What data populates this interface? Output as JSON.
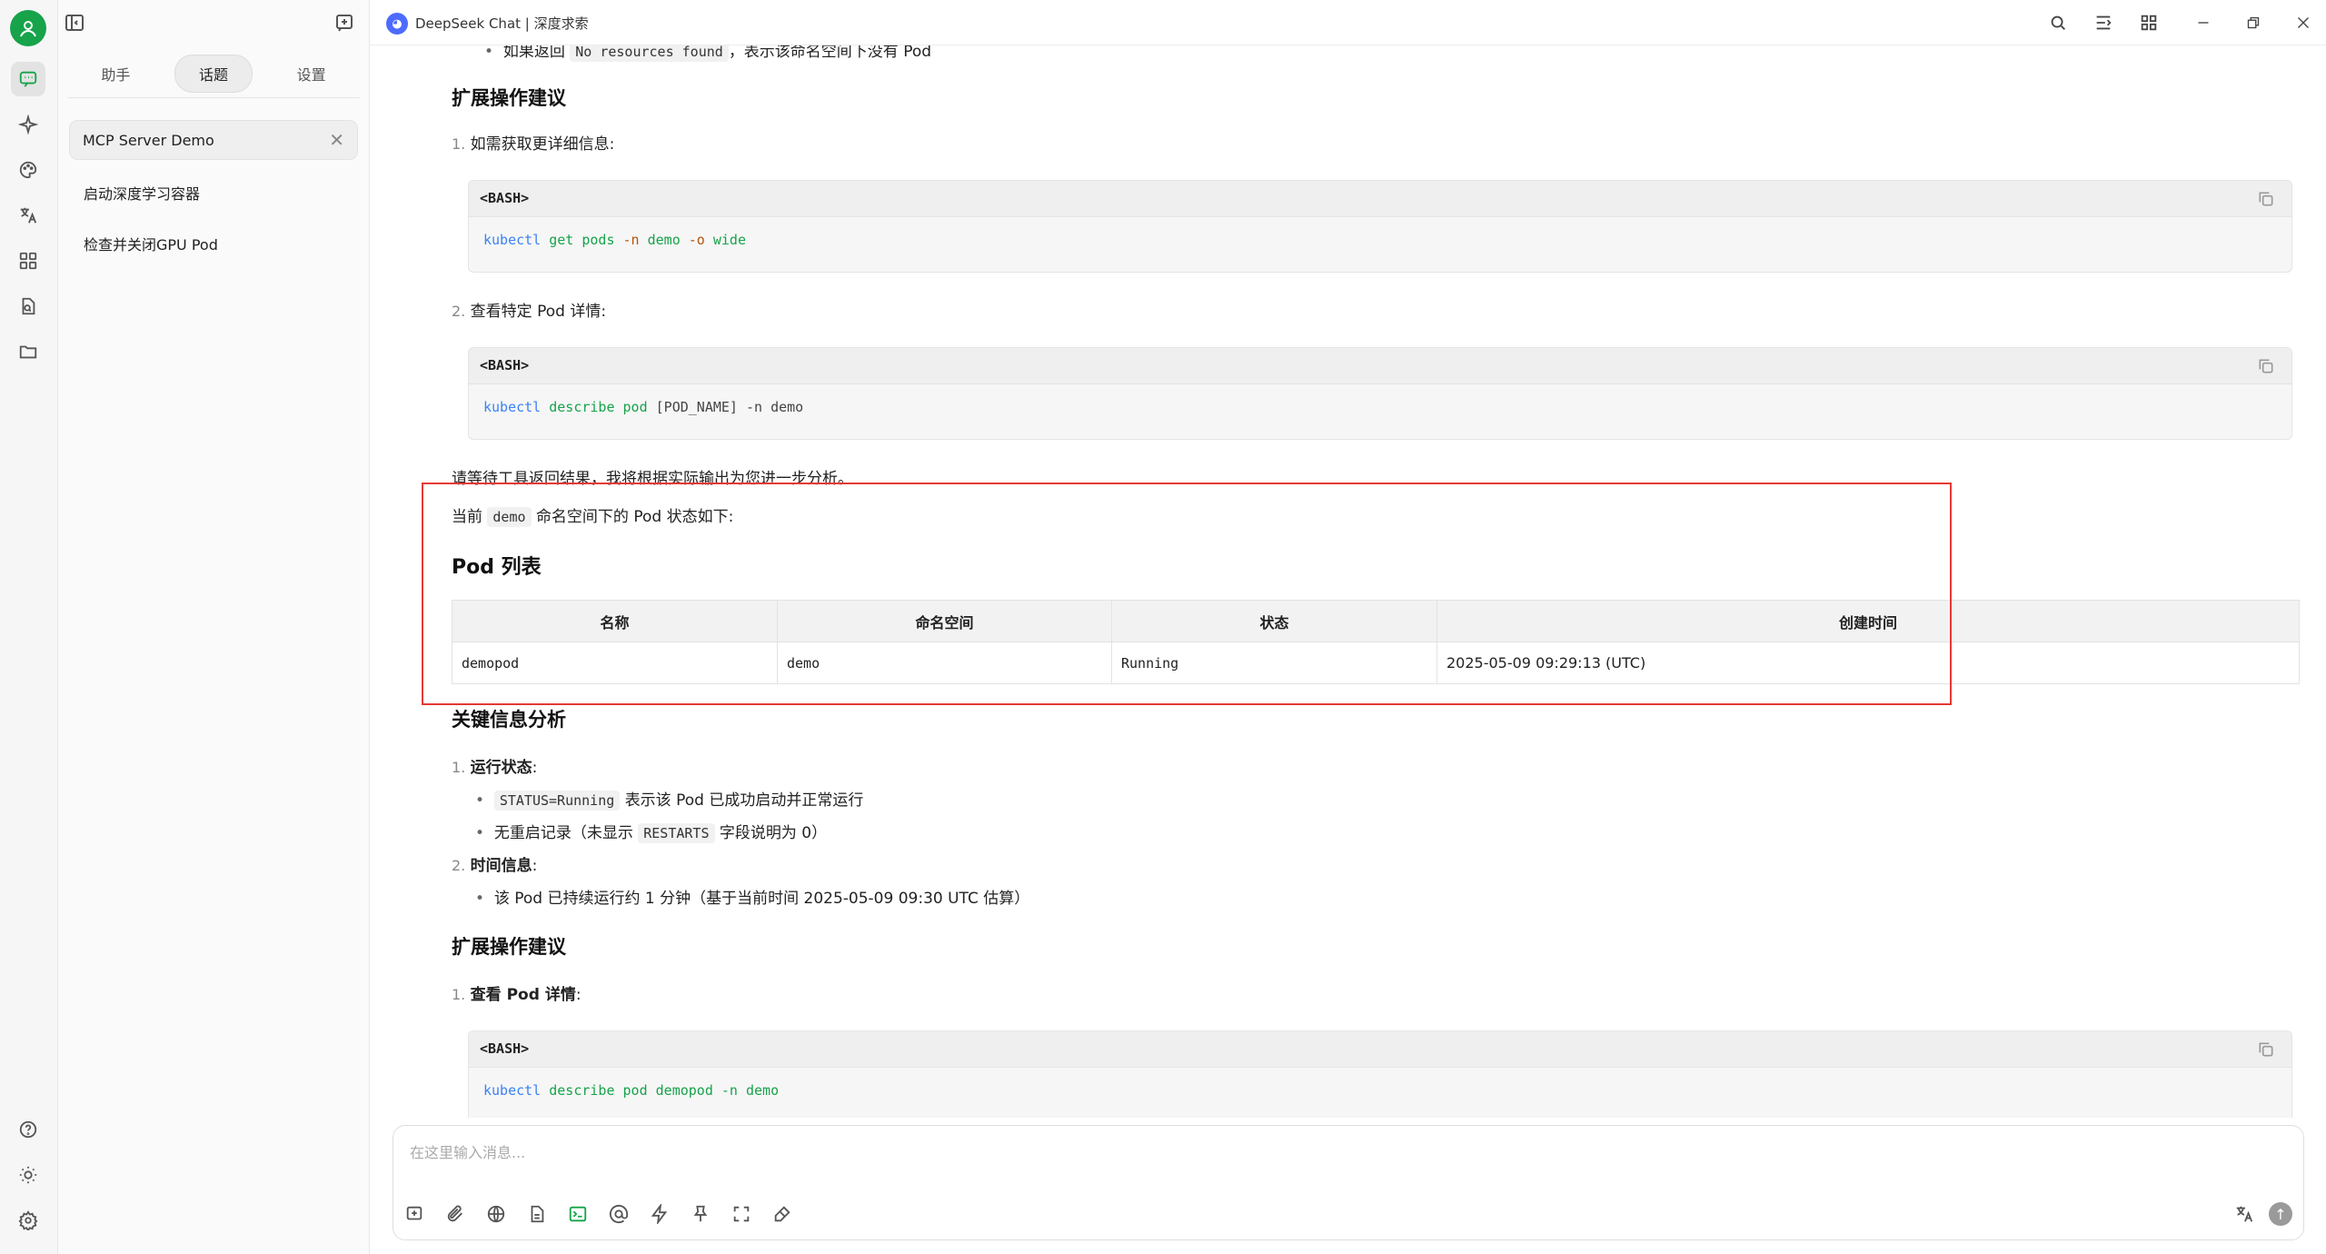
{
  "window": {
    "title": "DeepSeek Chat | 深度求索"
  },
  "sidebar": {
    "tabs": [
      "助手",
      "话题",
      "设置"
    ],
    "active_tab": "话题",
    "search_value": "MCP Server Demo",
    "topics": [
      "启动深度学习容器",
      "检查并关闭GPU Pod"
    ]
  },
  "chat": {
    "top_partial": {
      "prefix": "如果返回 ",
      "code": "No resources found",
      "suffix": "，表示该命名空间下没有 Pod"
    },
    "section1_title": "扩展操作建议",
    "s1_item1": "如需获取更详细信息:",
    "s1_code1": {
      "lang": "<BASH>",
      "cmd": "kubectl",
      "tokens": [
        "get",
        "pods",
        "-n",
        "demo",
        "-o",
        "wide"
      ]
    },
    "s1_item2": "查看特定 Pod 详情:",
    "s1_code2": {
      "lang": "<BASH>",
      "cmd": "kubectl",
      "sub": "describe pod",
      "arg": "[POD_NAME]",
      "flag": "-n demo"
    },
    "wait_note": "请等待工具返回结果，我将根据实际输出为您进一步分析。",
    "intro_prefix": "当前",
    "intro_code": "demo",
    "intro_suffix": "命名空间下的 Pod 状态如下:",
    "pod_list_title": "Pod 列表",
    "table": {
      "headers": [
        "名称",
        "命名空间",
        "状态",
        "创建时间"
      ],
      "rows": [
        [
          "demopod",
          "demo",
          "Running",
          "2025-05-09 09:29:13 (UTC)"
        ]
      ]
    },
    "analysis_title": "关键信息分析",
    "a_item1_label": "运行状态",
    "a_item1_b1_code": "STATUS=Running",
    "a_item1_b1_text": "表示该 Pod 已成功启动并正常运行",
    "a_item1_b2_prefix": "无重启记录（未显示",
    "a_item1_b2_code": "RESTARTS",
    "a_item1_b2_suffix": "字段说明为 0）",
    "a_item2_label": "时间信息",
    "a_item2_b1": "该 Pod 已持续运行约 1 分钟（基于当前时间 2025-05-09 09:30 UTC 估算）",
    "section2_title": "扩展操作建议",
    "s2_item1_label": "查看 Pod 详情",
    "s2_code1": {
      "lang": "<BASH>",
      "cmd": "kubectl",
      "sub": "describe pod demopod",
      "flag": "-n demo"
    }
  },
  "composer": {
    "placeholder": "在这里输入消息..."
  },
  "colors": {
    "accent": "#16a34a",
    "highlight_border": "#e53935",
    "brand_logo": "#4d6bfe"
  },
  "icons": {
    "rail": [
      "chat-icon",
      "sparkle-icon",
      "palette-icon",
      "translate-icon",
      "apps-icon",
      "file-search-icon",
      "folder-icon",
      "help-icon",
      "theme-icon",
      "settings-icon"
    ],
    "titlebar": [
      "search-icon",
      "layout-icon",
      "grid-icon",
      "minimize-icon",
      "restore-icon",
      "close-icon"
    ],
    "composer": [
      "new-topic-icon",
      "attach-icon",
      "web-icon",
      "doc-icon",
      "terminal-icon",
      "mention-icon",
      "bolt-icon",
      "pin-icon",
      "fullscreen-icon",
      "eraser-icon",
      "translate-icon",
      "send-icon"
    ]
  }
}
